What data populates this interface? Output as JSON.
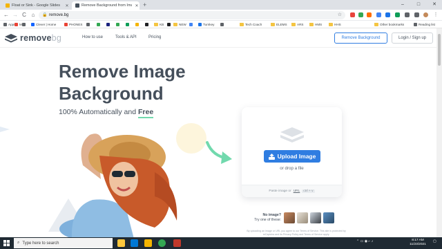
{
  "browser": {
    "tabs": [
      {
        "title": "Float or Sink - Google Slides",
        "active": false
      },
      {
        "title": "Remove Background from Imag",
        "active": true
      }
    ],
    "new_tab": "+",
    "back": "←",
    "forward": "→",
    "reload": "C",
    "home": "⌂",
    "url": "remove.bg",
    "window_controls": {
      "minimize": "–",
      "maximize": "□",
      "close": "✕"
    }
  },
  "bookmarks": {
    "items": [
      "Apps",
      "M",
      "",
      "Clever | Home",
      "",
      "PHONES",
      "",
      "",
      "",
      "",
      "",
      "",
      "KB",
      "",
      "NEW",
      "",
      "Turnkey",
      "",
      "Tech Coach",
      "ELEMS",
      "ARS",
      "HMS",
      "HHS"
    ],
    "other": "Other bookmarks",
    "reading": "Reading list"
  },
  "site": {
    "logo": {
      "main": "remove",
      "suffix": "bg"
    },
    "nav": [
      "How to use",
      "Tools & API",
      "Pricing"
    ],
    "cta_remove": "Remove Background",
    "cta_login": "Login / Sign up"
  },
  "hero": {
    "title_line1": "Remove Image",
    "title_line2": "Background",
    "subtitle_prefix": "100% Automatically and ",
    "subtitle_free": "Free",
    "upload_label": "Upload Image",
    "drop_text": "or drop a file",
    "paste_prefix": "Paste image or",
    "paste_url": "URL",
    "paste_keys": "ctrl + v",
    "no_image_line1": "No image?",
    "no_image_line2": "Try one of these:",
    "legal": "By uploading an image or URL you agree to our Terms of Service. This site is protected by reCaptcha and its Privacy Policy and Terms of Service apply."
  },
  "taskbar": {
    "search_placeholder": "Type here to search",
    "time": "8:17 AM",
    "date": "11/23/2021"
  },
  "colors": {
    "accent": "#2f7de1",
    "mint": "#71d9ad",
    "text": "#454f5b",
    "taskbar": "#1f2a33"
  }
}
